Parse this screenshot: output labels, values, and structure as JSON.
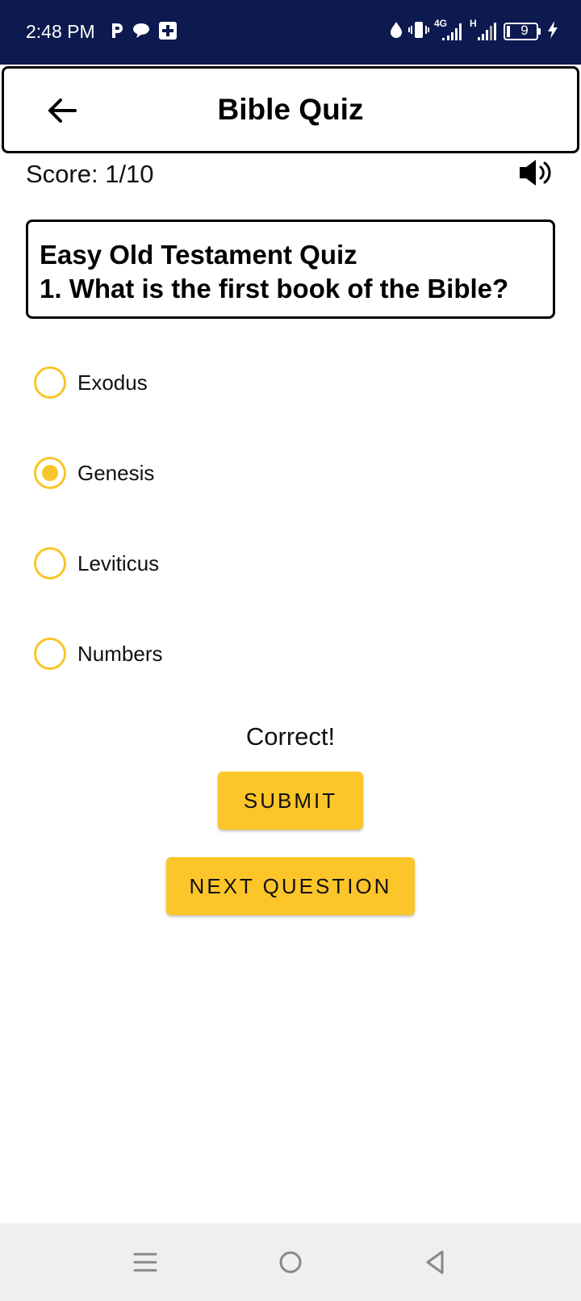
{
  "status_bar": {
    "time": "2:48 PM",
    "network_label": "4G",
    "network2_label": "H",
    "battery_level": "9",
    "left_icons": [
      "p-icon",
      "chat-bubble-icon",
      "medical-plus-icon"
    ],
    "right_icons": [
      "water-drop-icon",
      "vibrate-icon",
      "signal-icon",
      "signal-icon",
      "battery-icon",
      "charging-bolt-icon"
    ]
  },
  "app_bar": {
    "title": "Bible Quiz",
    "back_icon": "arrow-left-icon"
  },
  "score": {
    "text": "Score: 1/10",
    "sound_icon": "speaker-volume-icon"
  },
  "question": {
    "quiz_title": "Easy Old Testament Quiz",
    "text": "1. What is the first book of the Bible?"
  },
  "options": [
    {
      "label": "Exodus",
      "selected": false
    },
    {
      "label": "Genesis",
      "selected": true
    },
    {
      "label": "Leviticus",
      "selected": false
    },
    {
      "label": "Numbers",
      "selected": false
    }
  ],
  "feedback": "Correct!",
  "buttons": {
    "submit": "SUBMIT",
    "next": "NEXT QUESTION"
  },
  "nav_bar": {
    "icons": [
      "menu-icon",
      "home-circle-icon",
      "back-triangle-icon"
    ]
  },
  "colors": {
    "status_bar_bg": "#0d1a4f",
    "accent_yellow": "#fcc52a",
    "radio_yellow": "#f7c628",
    "nav_bar_bg": "#efefef"
  }
}
